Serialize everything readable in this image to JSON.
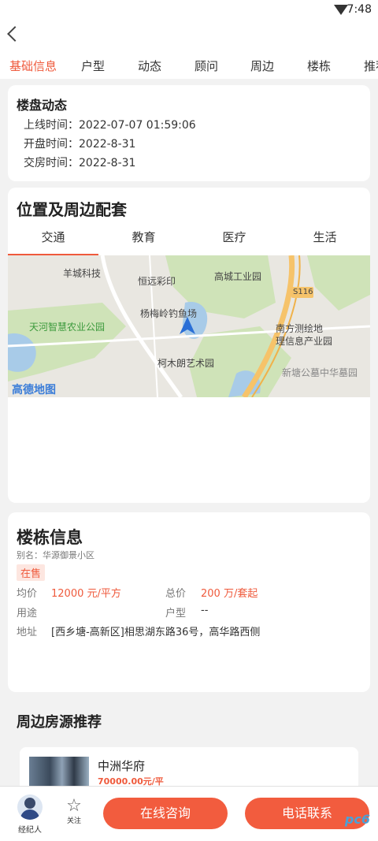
{
  "status": {
    "time": "7:48"
  },
  "tabs": [
    "基础信息",
    "户型",
    "动态",
    "顾问",
    "周边",
    "楼栋",
    "推荐"
  ],
  "dynamics": {
    "title": "楼盘动态",
    "online": "上线时间：2022-07-07 01:59:06",
    "open": "开盘时间：2022-8-31",
    "delivery": "交房时间：2022-8-31"
  },
  "location": {
    "title": "位置及周边配套",
    "subtabs": [
      "交通",
      "教育",
      "医疗",
      "生活"
    ],
    "map_labels": {
      "a": "羊城科技",
      "b": "恒远彩印",
      "c": "高城工业园",
      "d": "杨梅岭钓鱼场",
      "e": "S116",
      "f": "天河智慧农业公园",
      "g": "南方测绘地",
      "h": "理信息产业园",
      "i": "柯木朗艺术园",
      "j": "新塘公墓中华墓园",
      "k": "高德地图"
    }
  },
  "building": {
    "title": "楼栋信息",
    "alias": "别名：华源御景小区",
    "status": "在售",
    "avg_price_label": "均价",
    "avg_price": "12000 元/平方",
    "total_price_label": "总价",
    "total_price": "200 万/套起",
    "usage_label": "用途",
    "usage": "",
    "layout_label": "户型",
    "layout": "--",
    "address_label": "地址",
    "address": "[西乡塘-高新区]相思湖东路36号，高华路西侧"
  },
  "recommend": {
    "title": "周边房源推荐",
    "item_name": "中洲华府",
    "item_price": "70000.00元/平"
  },
  "bottom": {
    "agent": "经纪人",
    "follow": "关注",
    "chat": "在线咨询",
    "call": "电话联系",
    "watermark": "pc6"
  }
}
